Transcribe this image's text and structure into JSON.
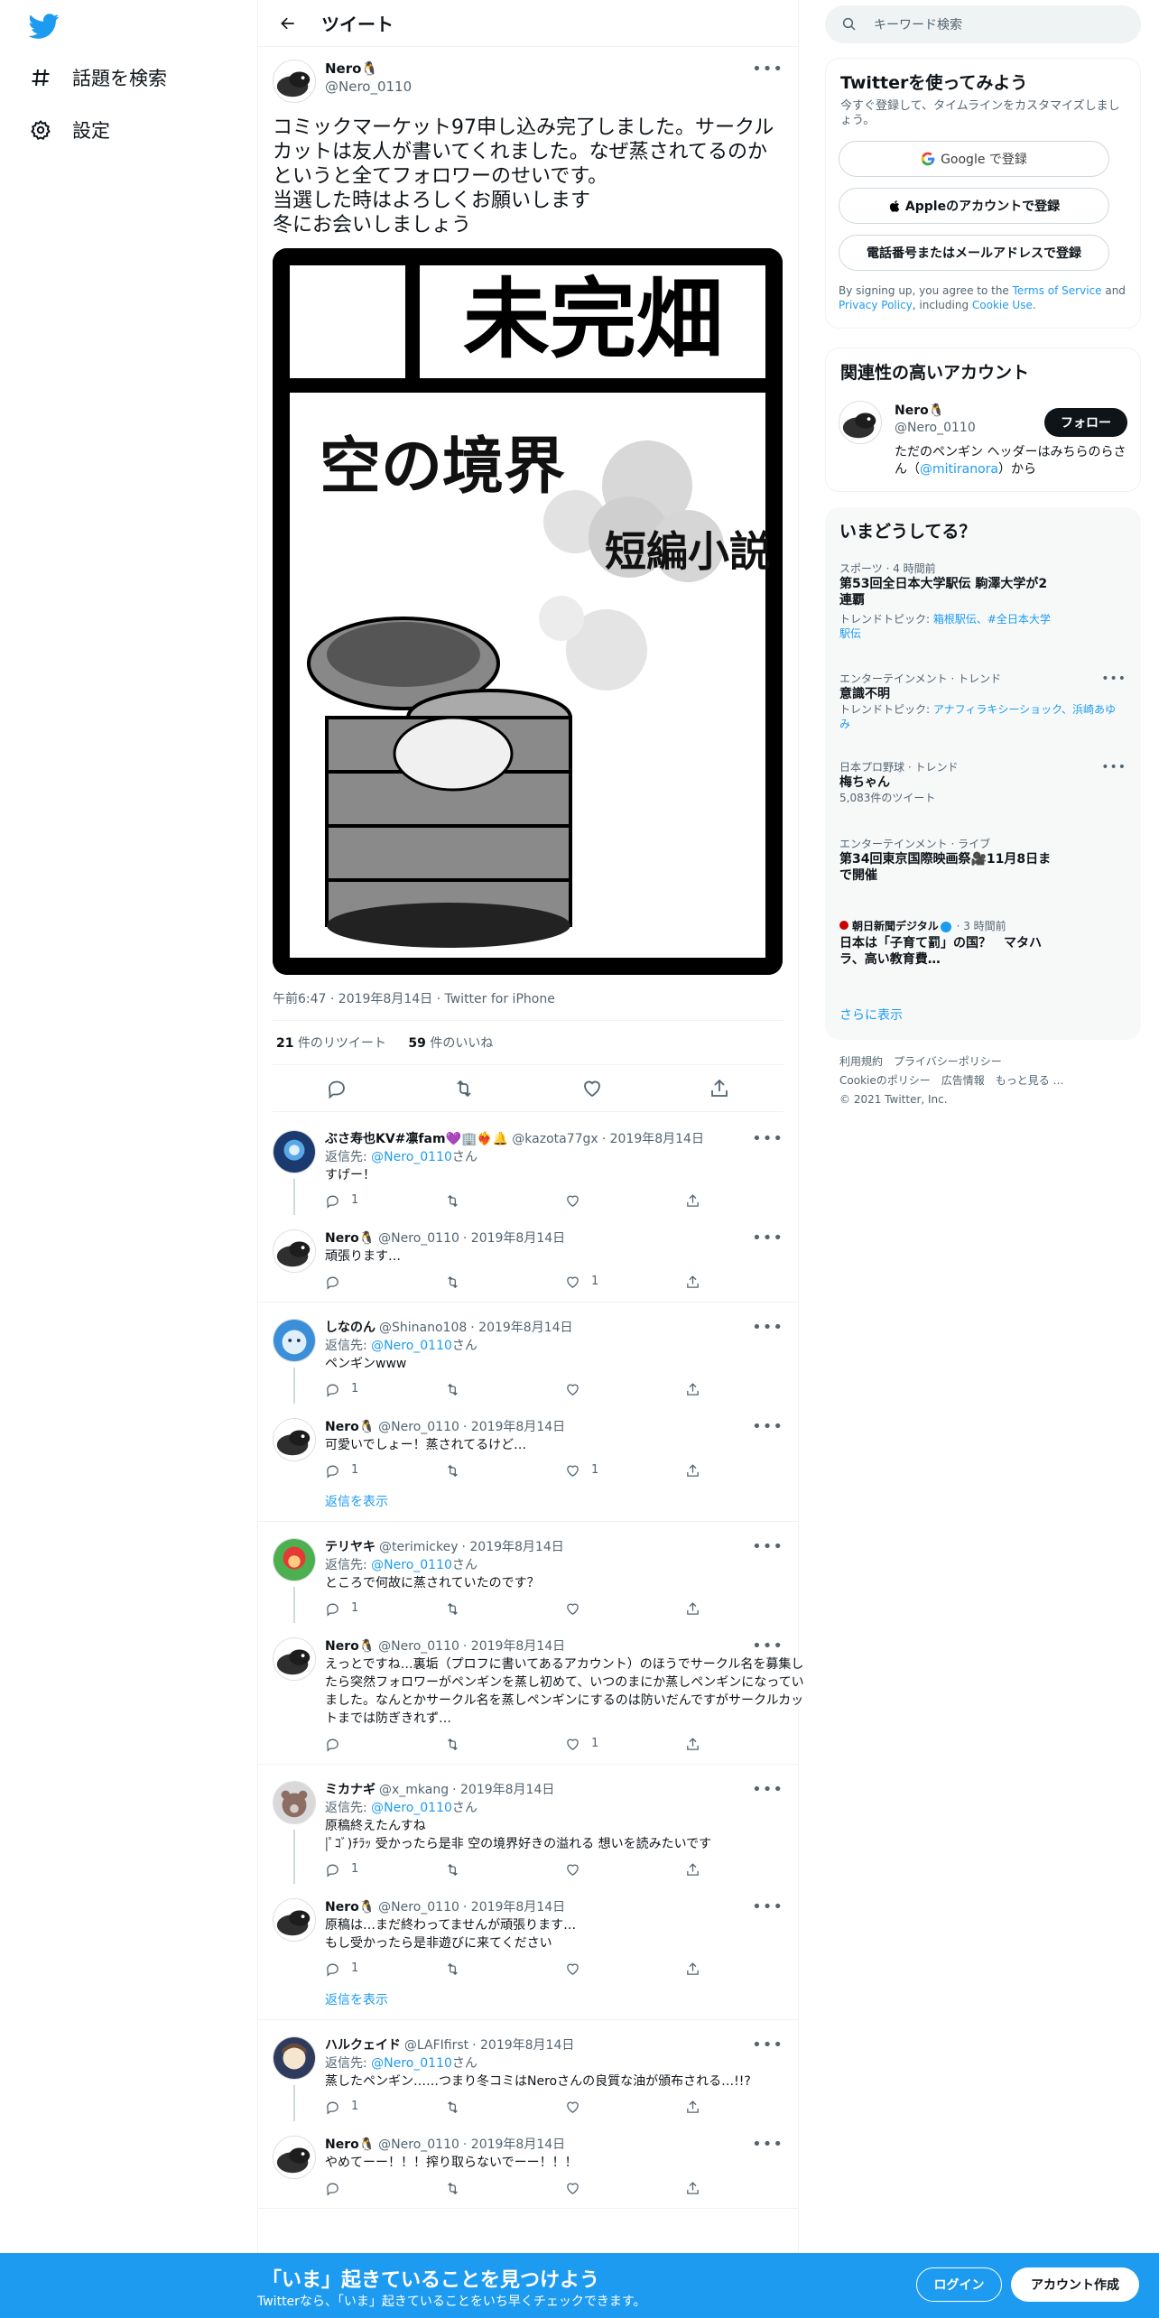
{
  "nav": {
    "logo": "twitter-bird-icon",
    "explore_label": "話題を検索",
    "settings_label": "設定"
  },
  "header": {
    "title": "ツイート"
  },
  "tweet": {
    "name": "Nero🐧",
    "handle": "@Nero_0110",
    "text": "コミックマーケット97申し込み完了しました。サークルカットは友人が書いてくれました。なぜ蒸されてるのかというと全てフォロワーのせいです。\n当選した時はよろしくお願いします\n冬にお会いしましょう",
    "image_texts": {
      "circle_name": "未完畑",
      "title": "空の境界",
      "subtitle": "短編小説"
    },
    "meta": "午前6:47 · 2019年8月14日 · Twitter for iPhone",
    "retweets": "21",
    "retweets_label": "件のリツイート",
    "likes": "59",
    "likes_label": "件のいいね"
  },
  "replies": [
    {
      "name": "ぶさ寿也KV#凛fam💜🏢❤️‍🔥🔔",
      "handle": "@kazota77gx",
      "date": "· 2019年8月14日",
      "replyto_prefix": "返信先: ",
      "replyto": "@Nero_0110",
      "replyto_suffix": "さん",
      "text": "すげー！",
      "reply_count": "1",
      "rt_count": "",
      "like_count": "",
      "avatar": "blue"
    },
    {
      "name": "Nero🐧",
      "handle": "@Nero_0110",
      "date": "· 2019年8月14日",
      "text": "頑張ります…",
      "reply_count": "",
      "rt_count": "",
      "like_count": "1",
      "avatar": "nero"
    },
    {
      "name": "しなのん",
      "handle": "@Shinano108",
      "date": "· 2019年8月14日",
      "replyto_prefix": "返信先: ",
      "replyto": "@Nero_0110",
      "replyto_suffix": "さん",
      "text": "ペンギンwww",
      "reply_count": "1",
      "rt_count": "",
      "like_count": "",
      "avatar": "lightblue"
    },
    {
      "name": "Nero🐧",
      "handle": "@Nero_0110",
      "date": "· 2019年8月14日",
      "text": "可愛いでしょー！蒸されてるけど…",
      "reply_count": "1",
      "rt_count": "",
      "like_count": "1",
      "avatar": "nero"
    },
    {
      "name": "テリヤキ",
      "handle": "@terimickey",
      "date": "· 2019年8月14日",
      "replyto_prefix": "返信先: ",
      "replyto": "@Nero_0110",
      "replyto_suffix": "さん",
      "text": "ところで何故に蒸されていたのです？",
      "reply_count": "1",
      "rt_count": "",
      "like_count": "",
      "avatar": "red"
    },
    {
      "name": "Nero🐧",
      "handle": "@Nero_0110",
      "date": "· 2019年8月14日",
      "text": "えっとですね…裏垢（プロフに書いてあるアカウント）のほうでサークル名を募集したら突然フォロワーがペンギンを蒸し初めて、いつのまにか蒸しペンギンになっていました。なんとかサークル名を蒸しペンギンにするのは防いだんですがサークルカットまでは防ぎきれず…",
      "reply_count": "",
      "rt_count": "",
      "like_count": "1",
      "avatar": "nero"
    },
    {
      "name": "ミカナギ",
      "handle": "@x_mkang",
      "date": "· 2019年8月14日",
      "replyto_prefix": "返信先: ",
      "replyto": "@Nero_0110",
      "replyto_suffix": "さん",
      "text": "原稿終えたんすね\n|ﾟｺﾞ)ﾁﾗｯ 受かったら是非 空の境界好きの溢れる 想いを読みたいです",
      "reply_count": "1",
      "rt_count": "",
      "like_count": "",
      "avatar": "bear"
    },
    {
      "name": "Nero🐧",
      "handle": "@Nero_0110",
      "date": "· 2019年8月14日",
      "text": "原稿は…まだ終わってませんが頑張ります…\nもし受かったら是非遊びに来てください",
      "reply_count": "1",
      "rt_count": "",
      "like_count": "",
      "avatar": "nero"
    },
    {
      "name": "ハルクェイド",
      "handle": "@LAFIfirst",
      "date": "· 2019年8月14日",
      "replyto_prefix": "返信先: ",
      "replyto": "@Nero_0110",
      "replyto_suffix": "さん",
      "text": "蒸したペンギン……つまり冬コミはNeroさんの良質な油が頒布される…!!?",
      "reply_count": "1",
      "rt_count": "",
      "like_count": "",
      "avatar": "anime"
    },
    {
      "name": "Nero🐧",
      "handle": "@Nero_0110",
      "date": "· 2019年8月14日",
      "text": "やめてーー！！！搾り取らないでーー！！！",
      "reply_count": "",
      "rt_count": "",
      "like_count": "",
      "avatar": "nero"
    }
  ],
  "show_replies_label": "返信を表示",
  "right": {
    "search_placeholder": "キーワード検索",
    "signup": {
      "title": "Twitterを使ってみよう",
      "subtitle": "今すぐ登録して、タイムラインをカスタマイズしましょう。",
      "google": "Google で登録",
      "apple": "Appleのアカウントで登録",
      "phone": "電話番号またはメールアドレスで登録",
      "legal_1": "By signing up, you agree to the ",
      "terms": "Terms of Service",
      "legal_2": " and ",
      "privacy": "Privacy Policy",
      "legal_3": ", including ",
      "cookie": "Cookie Use",
      "legal_4": "."
    },
    "related": {
      "title": "関連性の高いアカウント",
      "name": "Nero🐧",
      "handle": "@Nero_0110",
      "follow": "フォロー",
      "bio_1": "ただのペンギン ヘッダーはみちらのらさん（",
      "bio_link": "@mitiranora",
      "bio_2": "）から"
    },
    "trends": {
      "title": "いまどうしてる？",
      "items": [
        {
          "cat": "スポーツ · 4 時間前",
          "ttl": "第53回全日本大学駅伝 駒澤大学が2連覇",
          "extra_prefix": "トレンドトピック: ",
          "extra_links": "箱根駅伝、#全日本大学駅伝"
        },
        {
          "cat": "エンターテインメント · トレンド",
          "ttl": "意識不明",
          "extra_prefix": "トレンドトピック: ",
          "extra_links": "アナフィラキシーショック、浜崎あゆみ"
        },
        {
          "cat": "日本プロ野球 · トレンド",
          "ttl": "梅ちゃん",
          "extra": "5,083件のツイート"
        },
        {
          "cat": "エンターテインメント · ライブ",
          "ttl": "第34回東京国際映画祭🎥11月8日まで開催"
        },
        {
          "cat_src": "朝日新聞デジタル",
          "cat_time": " · 3 時間前",
          "ttl": "日本は「子育て罰」の国？　マタハラ、高い教育費…"
        }
      ],
      "show_more": "さらに表示"
    },
    "footer": {
      "line1": "利用規約　プライバシーポリシー",
      "line2": "Cookieのポリシー　広告情報　もっと見る …",
      "line3": "© 2021 Twitter, Inc."
    }
  },
  "bottom": {
    "title": "「いま」起きていることを見つけよう",
    "sub": "Twitterなら、「いま」起きていることをいち早くチェックできます。",
    "login": "ログイン",
    "signup": "アカウント作成"
  },
  "colors": {
    "brand": "#1d9bf0",
    "text": "#0f1419",
    "muted": "#536471"
  }
}
